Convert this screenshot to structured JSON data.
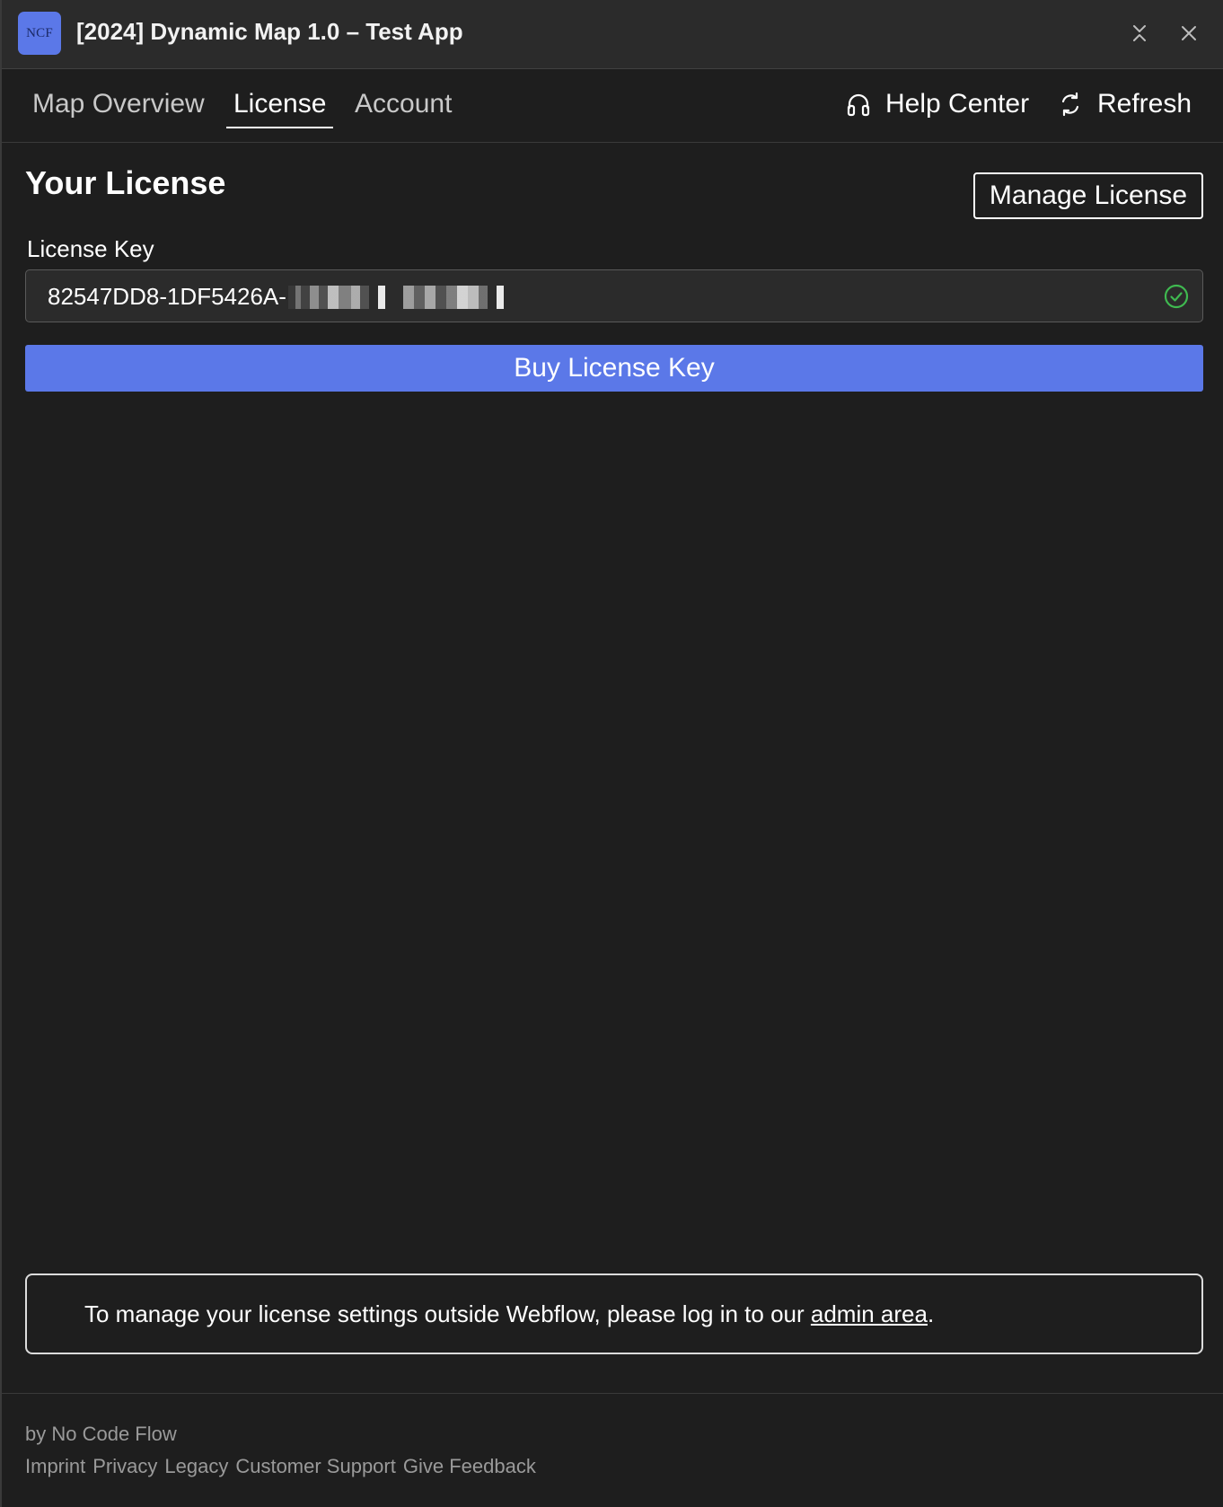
{
  "titlebar": {
    "logo_text": "NCF",
    "title": "[2024] Dynamic Map 1.0 – Test App",
    "icons": {
      "collapse": "collapse-icon",
      "close": "close-icon"
    }
  },
  "nav": {
    "tabs": [
      {
        "label": "Map Overview",
        "active": false
      },
      {
        "label": "License",
        "active": true
      },
      {
        "label": "Account",
        "active": false
      }
    ],
    "help_label": "Help Center",
    "refresh_label": "Refresh",
    "icons": {
      "help": "headphones-icon",
      "refresh": "refresh-icon"
    }
  },
  "license": {
    "title": "Your License",
    "manage_label": "Manage License",
    "field_label": "License Key",
    "key_value": "82547DD8-1DF5426A-",
    "key_status": "valid",
    "key_status_icon": "check-circle-icon",
    "buy_label": "Buy License Key"
  },
  "notice": {
    "text_before": "To manage your license settings outside Webflow, please log in to our ",
    "link_label": "admin area",
    "text_after": "."
  },
  "footer": {
    "by": "by No Code Flow",
    "links": [
      "Imprint",
      "Privacy",
      "Legacy",
      "Customer Support",
      "Give Feedback"
    ]
  },
  "colors": {
    "background": "#1e1e1e",
    "titlebar": "#2b2b2b",
    "accent": "#5b78e8",
    "success": "#3fb950",
    "muted_text": "#9a9a9a"
  }
}
